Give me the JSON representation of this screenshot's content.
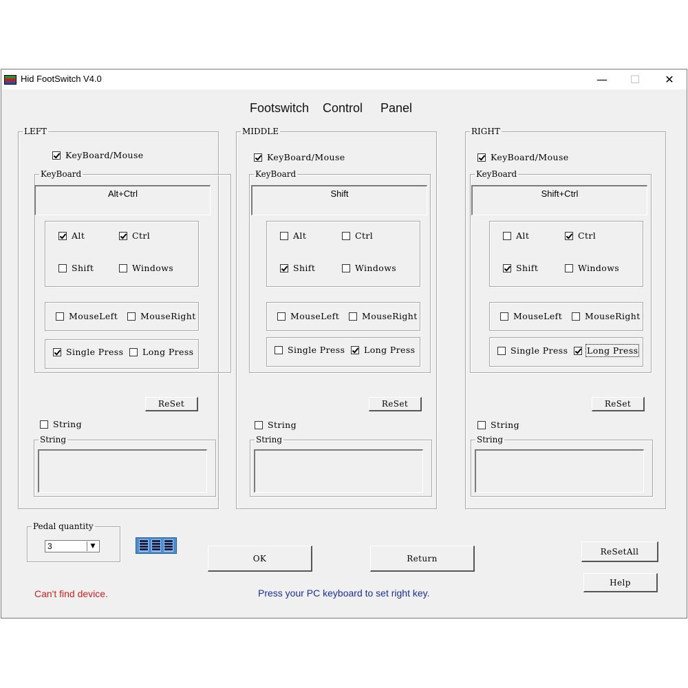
{
  "window": {
    "title": "Hid FootSwitch V4.0",
    "controls": {
      "minimize": "—",
      "maximize": "☐",
      "close": "✕"
    }
  },
  "header": {
    "words": [
      "Footswitch",
      "Control",
      "Panel"
    ]
  },
  "panels": [
    {
      "legend": "LEFT",
      "keyboard_mouse": {
        "label": "KeyBoard/Mouse",
        "checked": true
      },
      "keyboard_legend": "KeyBoard",
      "key_value": "Alt+Ctrl",
      "modifiers": [
        {
          "label": "Alt",
          "checked": true
        },
        {
          "label": "Ctrl",
          "checked": true
        },
        {
          "label": "Shift",
          "checked": false
        },
        {
          "label": "Windows",
          "checked": false
        }
      ],
      "mouse": [
        {
          "label": "MouseLeft",
          "checked": false
        },
        {
          "label": "MouseRight",
          "checked": false
        }
      ],
      "press": [
        {
          "label": "Single Press",
          "checked": true
        },
        {
          "label": "Long Press",
          "checked": false
        }
      ],
      "reset_label": "ReSet",
      "string_check": {
        "label": "String",
        "checked": false
      },
      "string_legend": "String",
      "string_value": ""
    },
    {
      "legend": "MIDDLE",
      "keyboard_mouse": {
        "label": "KeyBoard/Mouse",
        "checked": true
      },
      "keyboard_legend": "KeyBoard",
      "key_value": "Shift",
      "modifiers": [
        {
          "label": "Alt",
          "checked": false
        },
        {
          "label": "Ctrl",
          "checked": false
        },
        {
          "label": "Shift",
          "checked": true
        },
        {
          "label": "Windows",
          "checked": false
        }
      ],
      "mouse": [
        {
          "label": "MouseLeft",
          "checked": false
        },
        {
          "label": "MouseRight",
          "checked": false
        }
      ],
      "press": [
        {
          "label": "Single Press",
          "checked": false
        },
        {
          "label": "Long Press",
          "checked": true
        }
      ],
      "reset_label": "ReSet",
      "string_check": {
        "label": "String",
        "checked": false
      },
      "string_legend": "String",
      "string_value": ""
    },
    {
      "legend": "RIGHT",
      "keyboard_mouse": {
        "label": "KeyBoard/Mouse",
        "checked": true
      },
      "keyboard_legend": "KeyBoard",
      "key_value": "Shift+Ctrl",
      "modifiers": [
        {
          "label": "Alt",
          "checked": false
        },
        {
          "label": "Ctrl",
          "checked": true
        },
        {
          "label": "Shift",
          "checked": true
        },
        {
          "label": "Windows",
          "checked": false
        }
      ],
      "mouse": [
        {
          "label": "MouseLeft",
          "checked": false
        },
        {
          "label": "MouseRight",
          "checked": false
        }
      ],
      "press": [
        {
          "label": "Single Press",
          "checked": false
        },
        {
          "label": "Long Press",
          "checked": true
        }
      ],
      "reset_label": "ReSet",
      "string_check": {
        "label": "String",
        "checked": false
      },
      "string_legend": "String",
      "string_value": ""
    }
  ],
  "pedal_quantity": {
    "legend": "Pedal quantity",
    "value": "3"
  },
  "buttons": {
    "ok": "OK",
    "return": "Return",
    "reset_all": "ReSetAll",
    "help": "Help"
  },
  "status": {
    "device": "Can't find device.",
    "hint": "Press your PC keyboard to set right key.",
    "device_color": "#d02020",
    "hint_color": "#1a2ea0"
  }
}
